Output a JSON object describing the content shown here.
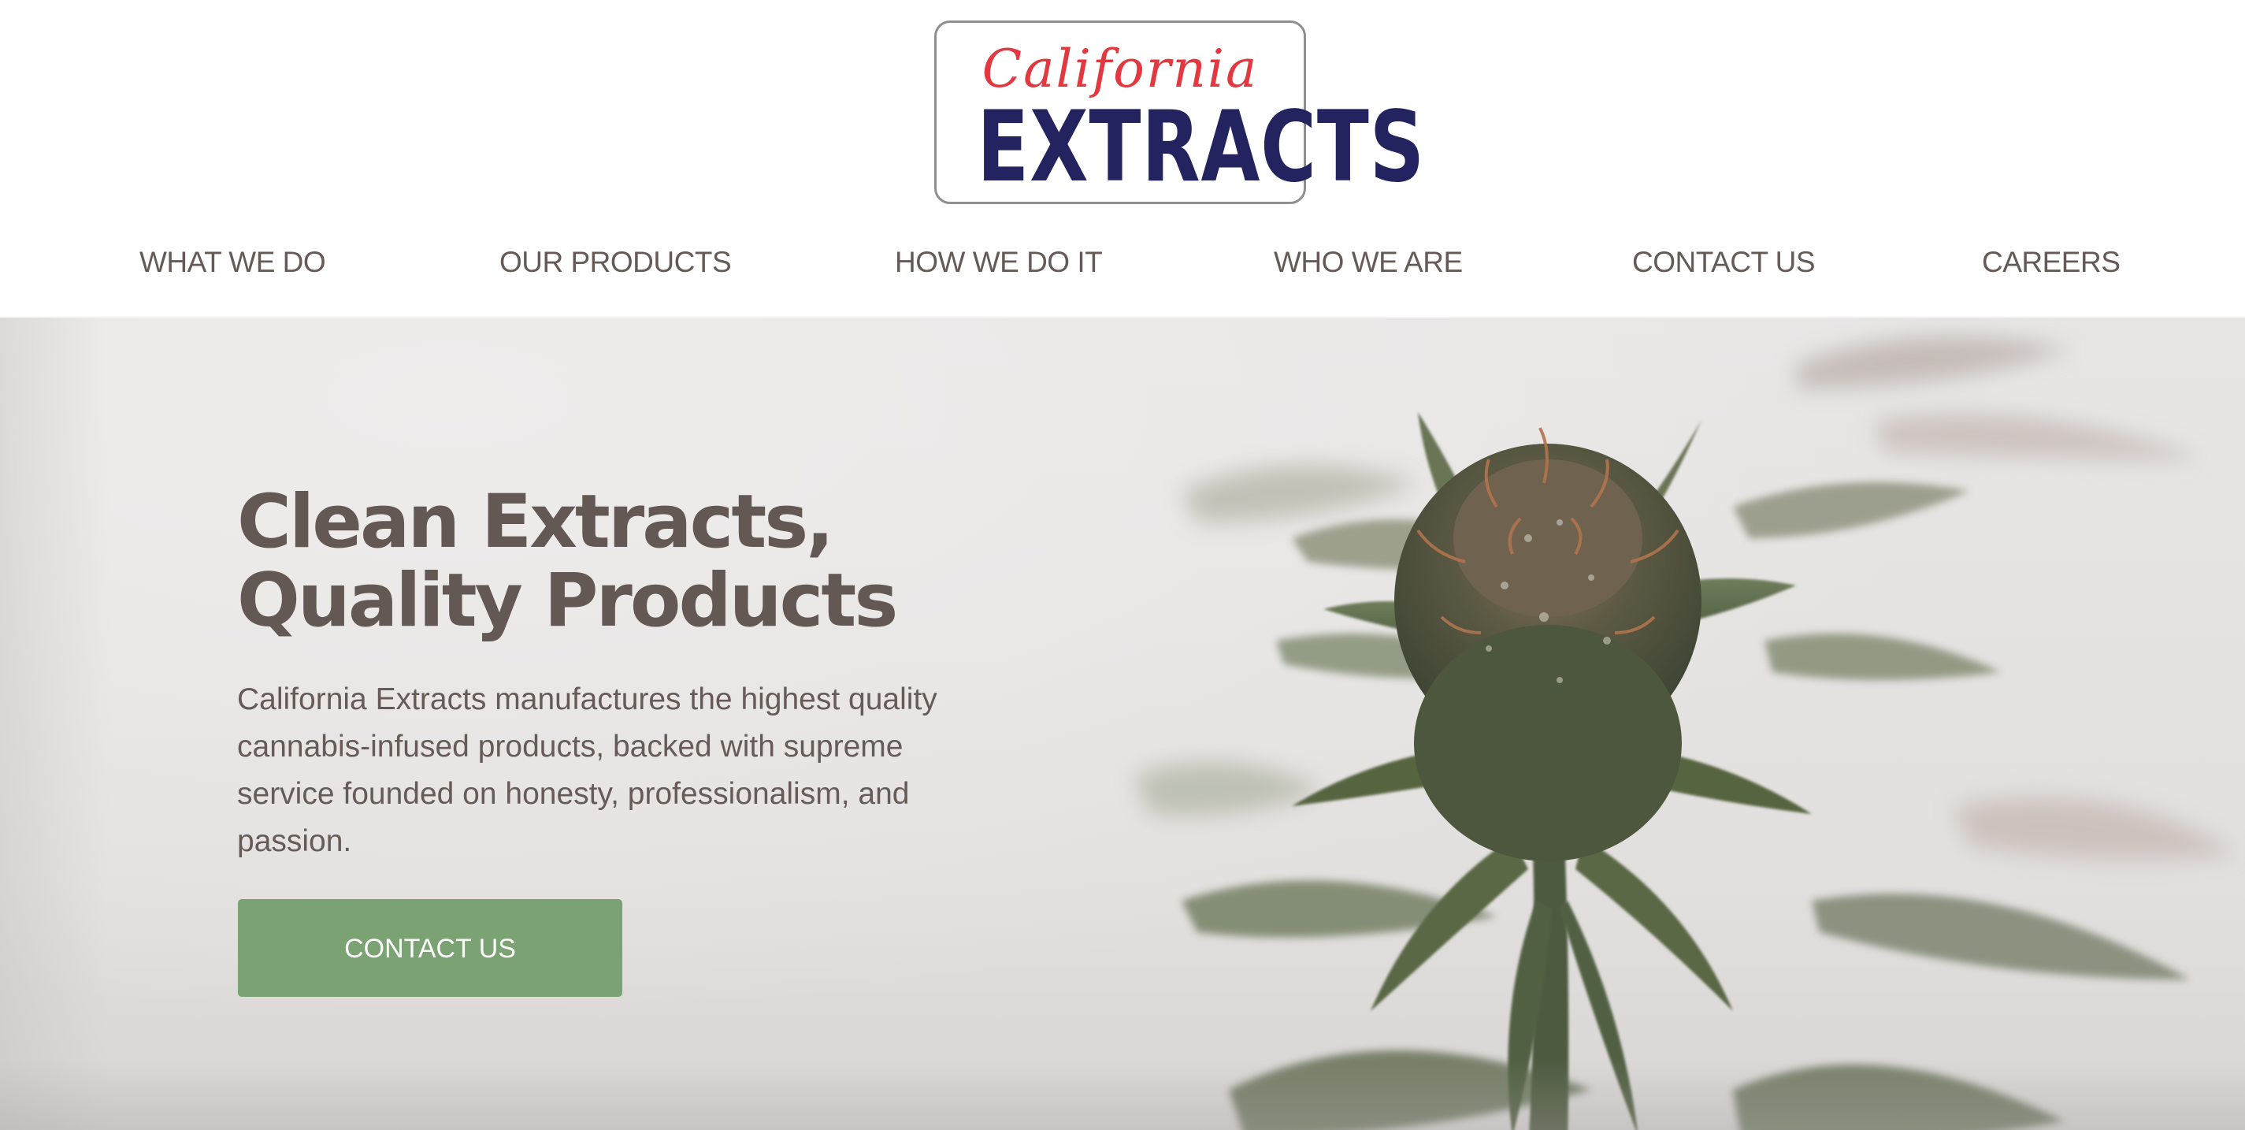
{
  "header": {
    "logo": {
      "script_text": "California",
      "main_text": "EXTRACTS",
      "script_color": "#e2383f",
      "main_color": "#23245f",
      "border_color": "#8f8f8f"
    },
    "nav": [
      {
        "label": "WHAT WE DO"
      },
      {
        "label": "OUR PRODUCTS"
      },
      {
        "label": "HOW WE DO IT"
      },
      {
        "label": "WHO WE ARE"
      },
      {
        "label": "CONTACT US"
      },
      {
        "label": "CAREERS"
      }
    ],
    "nav_color": "#655a55"
  },
  "hero": {
    "title_line1": "Clean Extracts,",
    "title_line2": "Quality Products",
    "description": "California Extracts manufactures the highest quality cannabis-infused products, backed with supreme service founded on honesty, professionalism, and passion.",
    "cta_label": "CONTACT US",
    "cta_color": "#7aa272",
    "text_color": "#635853",
    "image": "cannabis-plant-photo"
  }
}
